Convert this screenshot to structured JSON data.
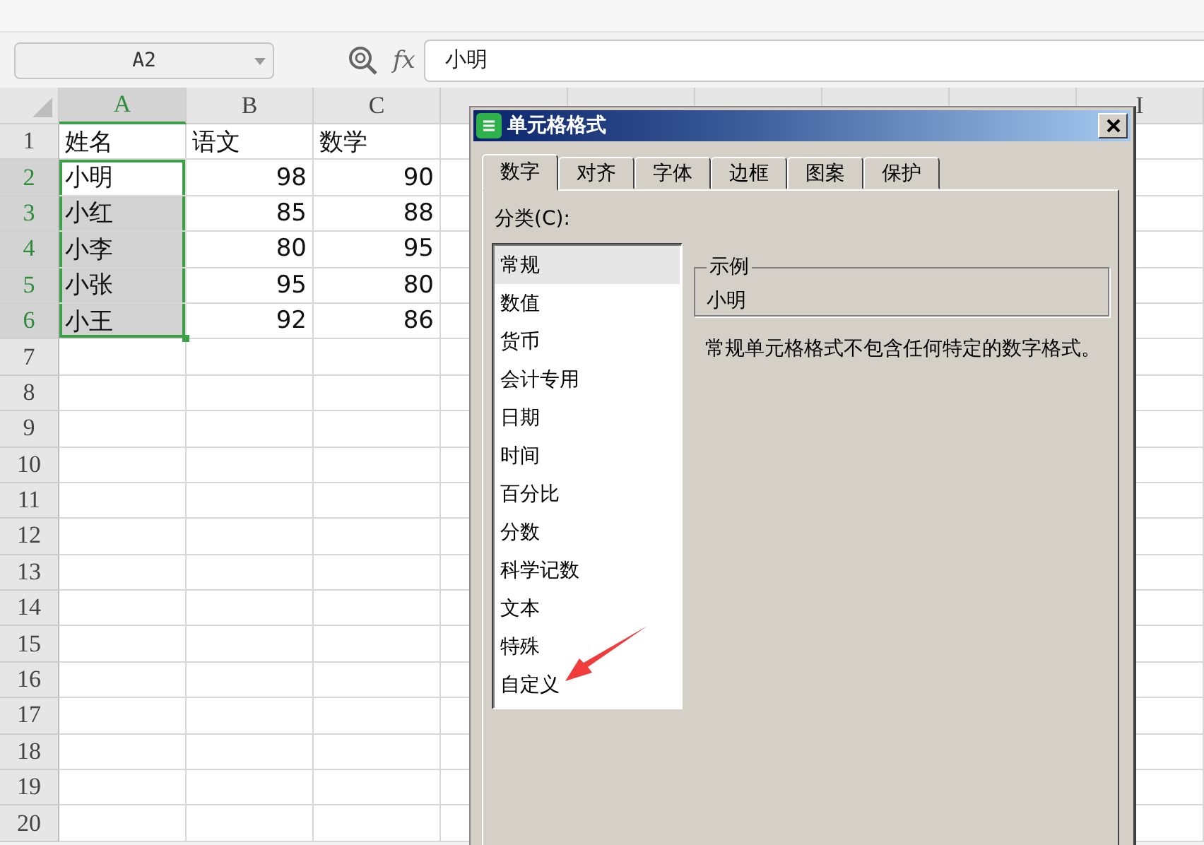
{
  "name_box": {
    "value": "A2"
  },
  "formula_bar": {
    "fx_label": "fx",
    "value": "小明"
  },
  "columns": [
    {
      "label": "A",
      "selected": true
    },
    {
      "label": "B",
      "selected": false
    },
    {
      "label": "C",
      "selected": false
    }
  ],
  "far_column": {
    "label": "I"
  },
  "rows": [
    {
      "number": "1",
      "selected": false,
      "kind": "header",
      "cells": [
        "姓名",
        "语文",
        "数学"
      ]
    },
    {
      "number": "2",
      "selected": true,
      "kind": "data",
      "cells": [
        "小明",
        "98",
        "90"
      ]
    },
    {
      "number": "3",
      "selected": true,
      "kind": "data",
      "cells": [
        "小红",
        "85",
        "88"
      ]
    },
    {
      "number": "4",
      "selected": true,
      "kind": "data",
      "cells": [
        "小李",
        "80",
        "95"
      ]
    },
    {
      "number": "5",
      "selected": true,
      "kind": "data",
      "cells": [
        "小张",
        "95",
        "80"
      ]
    },
    {
      "number": "6",
      "selected": true,
      "kind": "data",
      "cells": [
        "小王",
        "92",
        "86"
      ]
    },
    {
      "number": "7",
      "selected": false,
      "kind": "data"
    },
    {
      "number": "8",
      "selected": false,
      "kind": "data"
    },
    {
      "number": "9",
      "selected": false,
      "kind": "data"
    },
    {
      "number": "10",
      "selected": false,
      "kind": "data"
    },
    {
      "number": "11",
      "selected": false,
      "kind": "data"
    },
    {
      "number": "12",
      "selected": false,
      "kind": "data"
    },
    {
      "number": "13",
      "selected": false,
      "kind": "data"
    },
    {
      "number": "14",
      "selected": false,
      "kind": "data"
    },
    {
      "number": "15",
      "selected": false,
      "kind": "data"
    },
    {
      "number": "16",
      "selected": false,
      "kind": "data"
    },
    {
      "number": "17",
      "selected": false,
      "kind": "data"
    },
    {
      "number": "18",
      "selected": false,
      "kind": "data"
    },
    {
      "number": "19",
      "selected": false,
      "kind": "data"
    },
    {
      "number": "20",
      "selected": false,
      "kind": "data"
    }
  ],
  "dialog": {
    "title": "单元格格式",
    "tabs": [
      {
        "label": "数字",
        "selected": true
      },
      {
        "label": "对齐",
        "selected": false
      },
      {
        "label": "字体",
        "selected": false
      },
      {
        "label": "边框",
        "selected": false
      },
      {
        "label": "图案",
        "selected": false
      },
      {
        "label": "保护",
        "selected": false
      }
    ],
    "category_label": "分类(C):",
    "categories": [
      {
        "label": "常规",
        "selected": true
      },
      {
        "label": "数值",
        "selected": false
      },
      {
        "label": "货币",
        "selected": false
      },
      {
        "label": "会计专用",
        "selected": false
      },
      {
        "label": "日期",
        "selected": false
      },
      {
        "label": "时间",
        "selected": false
      },
      {
        "label": "百分比",
        "selected": false
      },
      {
        "label": "分数",
        "selected": false
      },
      {
        "label": "科学记数",
        "selected": false
      },
      {
        "label": "文本",
        "selected": false
      },
      {
        "label": "特殊",
        "selected": false
      },
      {
        "label": "自定义",
        "selected": false
      }
    ],
    "sample": {
      "legend": "示例",
      "value": "小明"
    },
    "description": "常规单元格格式不包含任何特定的数字格式。"
  }
}
